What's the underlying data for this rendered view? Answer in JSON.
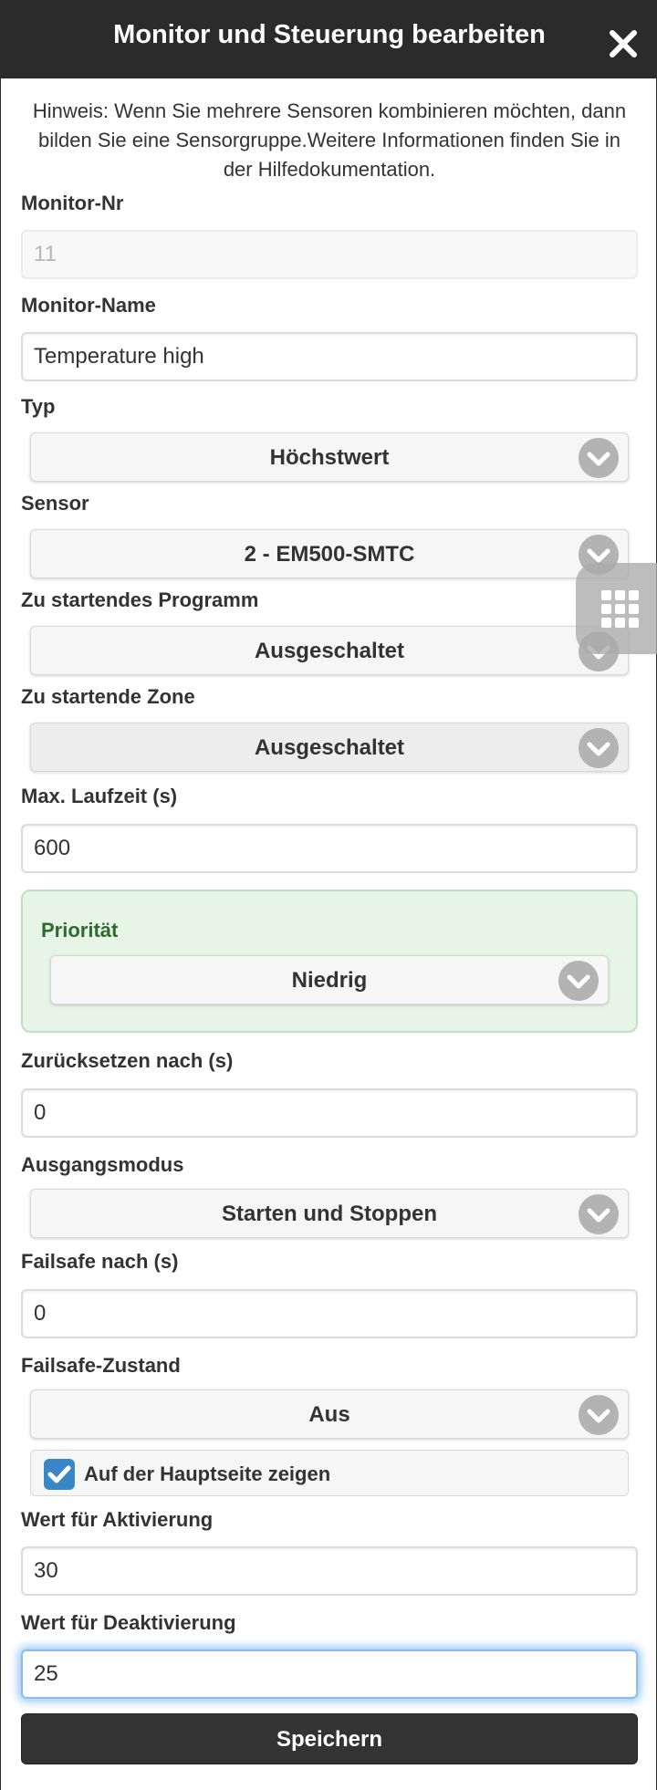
{
  "dialog": {
    "title": "Monitor und Steuerung bearbeiten",
    "hint": "Hinweis: Wenn Sie mehrere Sensoren kombinieren möchten, dann bilden Sie eine Sensorgruppe.Weitere Informationen finden Sie in der Hilfedokumentation."
  },
  "form": {
    "monitor_nr": {
      "label": "Monitor-Nr",
      "value": "11"
    },
    "monitor_name": {
      "label": "Monitor-Name",
      "value": "Temperature high"
    },
    "typ": {
      "label": "Typ",
      "value": "Höchstwert"
    },
    "sensor": {
      "label": "Sensor",
      "value": "2 - EM500-SMTC"
    },
    "program": {
      "label": "Zu startendes Programm",
      "value": "Ausgeschaltet"
    },
    "zone": {
      "label": "Zu startende Zone",
      "value": "Ausgeschaltet"
    },
    "max_runtime": {
      "label": "Max. Laufzeit (s)",
      "value": "600"
    },
    "priority": {
      "label": "Priorität",
      "value": "Niedrig"
    },
    "reset_after": {
      "label": "Zurücksetzen nach (s)",
      "value": "0"
    },
    "output_mode": {
      "label": "Ausgangsmodus",
      "value": "Starten und Stoppen"
    },
    "failsafe_after": {
      "label": "Failsafe nach (s)",
      "value": "0"
    },
    "failsafe_state": {
      "label": "Failsafe-Zustand",
      "value": "Aus"
    },
    "show_main": {
      "label": "Auf der Hauptseite zeigen",
      "checked": true
    },
    "activation_value": {
      "label": "Wert für Aktivierung",
      "value": "30"
    },
    "deactivation_value": {
      "label": "Wert für Deaktivierung",
      "value": "25"
    }
  },
  "actions": {
    "save_label": "Speichern"
  },
  "icons": {
    "close": "close-icon",
    "chevron": "chevron-down-icon",
    "grid": "grid-icon",
    "check": "checkmark-icon"
  },
  "colors": {
    "header_bg": "#2b2b2b",
    "chevron_bg": "#b3b3b3",
    "priority_bg": "#e6f5e6",
    "priority_text": "#2e6b2e",
    "checkbox_bg": "#3a87c8",
    "focus_glow": "#3898ec"
  }
}
